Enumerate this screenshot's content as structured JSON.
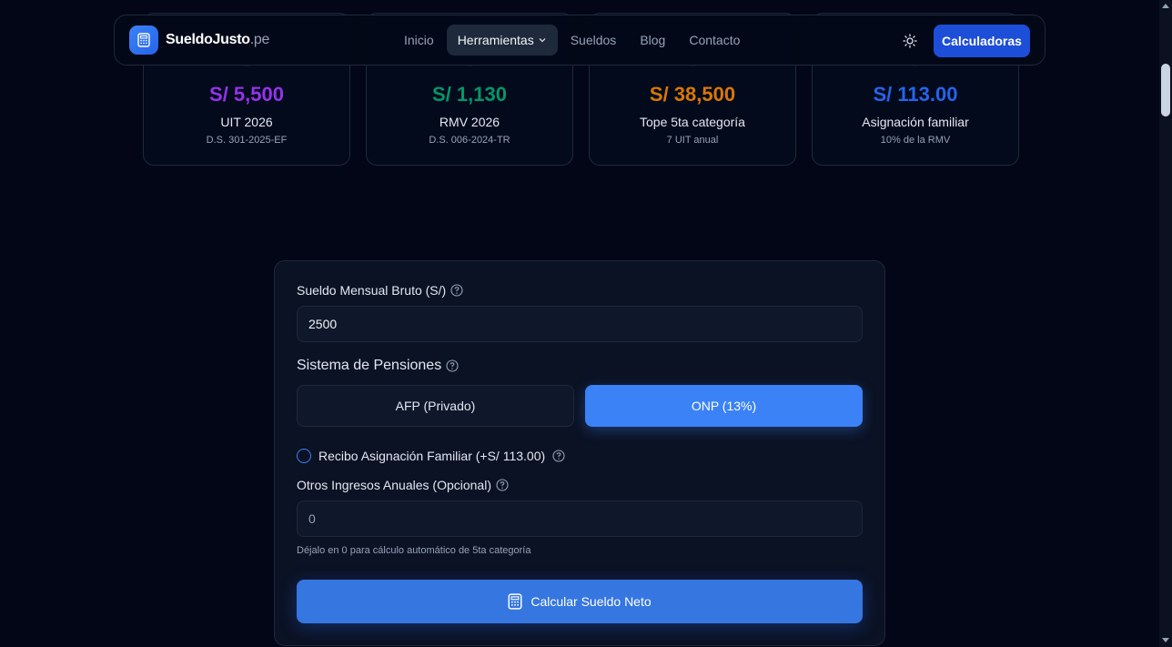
{
  "stats": [
    {
      "value": "S/ 5,500",
      "label": "UIT 2026",
      "sub": "D.S. 301-2025-EF",
      "color": "#9333ea"
    },
    {
      "value": "S/ 1,130",
      "label": "RMV 2026",
      "sub": "D.S. 006-2024-TR",
      "color": "#059669"
    },
    {
      "value": "S/ 38,500",
      "label": "Tope 5ta categoría",
      "sub": "7 UIT anual",
      "color": "#d97706"
    },
    {
      "value": "S/ 113.00",
      "label": "Asignación familiar",
      "sub": "10% de la RMV",
      "color": "#2563eb"
    }
  ],
  "nav": {
    "brand": "SueldoJusto",
    "brand_tld": ".pe",
    "links": [
      "Inicio",
      "Herramientas",
      "Sueldos",
      "Blog",
      "Contacto"
    ],
    "active_link": "Herramientas",
    "theme_icon": "sun-icon",
    "cta_label": "Calculadoras"
  },
  "form": {
    "salary_label": "Sueldo Mensual Bruto (S/)",
    "salary_value": "2500",
    "pension_label": "Sistema de Pensiones",
    "pension_options": [
      "AFP (Privado)",
      "ONP (13%)"
    ],
    "pension_selected": "ONP (13%)",
    "family_label": "Recibo Asignación Familiar (+S/ 113.00)",
    "other_income_label": "Otros Ingresos Anuales (Opcional)",
    "other_income_placeholder": "0",
    "hint": "Déjalo en 0 para cálculo automático de 5ta categoría",
    "submit_label": "Calcular Sueldo Neto",
    "accent": "#3b82f6"
  }
}
